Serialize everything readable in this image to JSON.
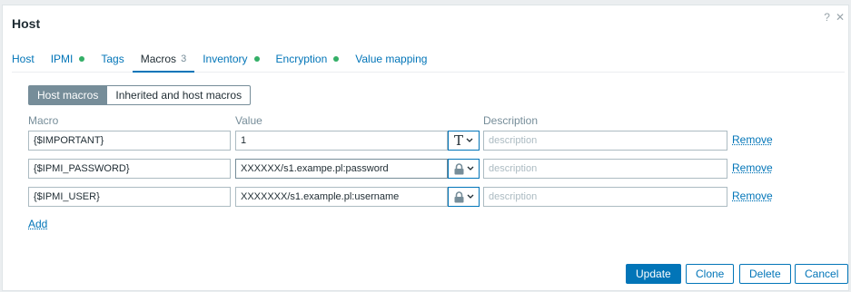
{
  "dialog": {
    "title": "Host",
    "help_icon": "?",
    "close_icon": "✕"
  },
  "tabs": [
    {
      "label": "Host"
    },
    {
      "label": "IPMI"
    },
    {
      "label": "Tags"
    },
    {
      "label": "Macros",
      "count": "3"
    },
    {
      "label": "Inventory"
    },
    {
      "label": "Encryption"
    },
    {
      "label": "Value mapping"
    }
  ],
  "macro_mode": {
    "host_macros": "Host macros",
    "inherited": "Inherited and host macros"
  },
  "columns": {
    "macro": "Macro",
    "value": "Value",
    "description": "Description"
  },
  "rows": [
    {
      "macro": "{$IMPORTANT}",
      "value": "1",
      "type_icon": "text-type-icon",
      "description_placeholder": "description",
      "remove": "Remove"
    },
    {
      "macro": "{$IPMI_PASSWORD}",
      "value": "XXXXXX/s1.exampe.pl:password",
      "type_icon": "lock-icon",
      "description_placeholder": "description",
      "remove": "Remove"
    },
    {
      "macro": "{$IPMI_USER}",
      "value": "XXXXXXX/s1.example.pl:username",
      "type_icon": "lock-icon",
      "description_placeholder": "description",
      "remove": "Remove"
    }
  ],
  "add_label": "Add",
  "buttons": {
    "update": "Update",
    "clone": "Clone",
    "delete": "Delete",
    "cancel": "Cancel"
  },
  "colors": {
    "accent": "#0275b8",
    "status_ok": "#34af67",
    "muted": "#768d99"
  }
}
